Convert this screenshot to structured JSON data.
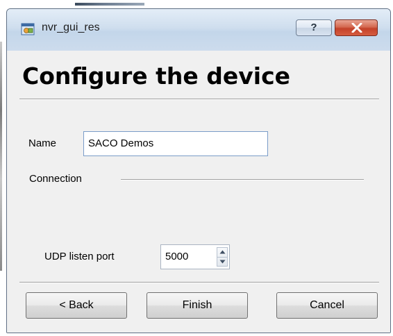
{
  "window": {
    "title": "nvr_gui_res",
    "help_label": "?",
    "app_icon": "app-window-icon",
    "close_icon": "close-icon"
  },
  "page": {
    "heading": "Configure the device"
  },
  "form": {
    "name_label": "Name",
    "name_value": "SACO Demos",
    "connection_label": "Connection",
    "udp_port_label": "UDP listen port",
    "udp_port_value": "5000"
  },
  "buttons": {
    "back": "< Back",
    "finish": "Finish",
    "cancel": "Cancel"
  },
  "colors": {
    "close_button": "#c3422a",
    "titlebar": "#cfdeee",
    "input_border": "#7a9cc8"
  }
}
